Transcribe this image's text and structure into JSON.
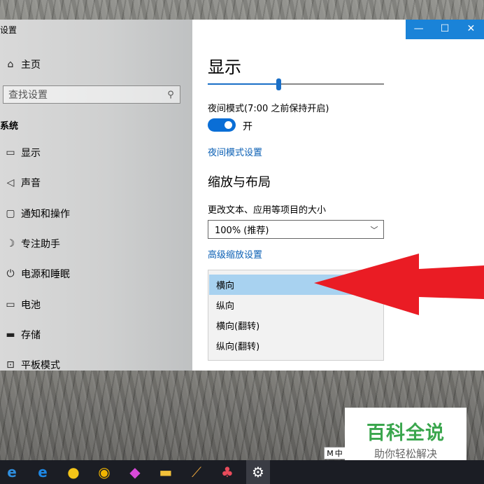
{
  "window": {
    "title": "设置",
    "controls": [
      "—",
      "☐",
      "✕"
    ]
  },
  "sidebar": {
    "home": "主页",
    "search_placeholder": "查找设置",
    "section": "系统",
    "items": [
      {
        "label": "显示",
        "icon": "monitor-icon"
      },
      {
        "label": "声音",
        "icon": "speaker-icon"
      },
      {
        "label": "通知和操作",
        "icon": "notification-icon"
      },
      {
        "label": "专注助手",
        "icon": "moon-icon"
      },
      {
        "label": "电源和睡眠",
        "icon": "power-icon"
      },
      {
        "label": "电池",
        "icon": "battery-icon"
      },
      {
        "label": "存储",
        "icon": "storage-icon"
      },
      {
        "label": "平板模式",
        "icon": "tablet-mode-icon"
      }
    ]
  },
  "main": {
    "title": "显示",
    "brightness_percent": 40,
    "night_light_label": "夜间模式(7:00 之前保持开启)",
    "night_light_state": "开",
    "night_light_on": true,
    "night_light_settings_link": "夜间模式设置",
    "scale_layout_heading": "缩放与布局",
    "scale_label": "更改文本、应用等项目的大小",
    "scale_value": "100% (推荐)",
    "advanced_scaling_link": "高级缩放设置",
    "orientation_options": [
      "横向",
      "纵向",
      "横向(翻转)",
      "纵向(翻转)"
    ],
    "orientation_selected": 0
  },
  "watermark": {
    "title": "百科全说",
    "subtitle": "助你轻松解决"
  },
  "ime": {
    "m": "M",
    "lang": "中"
  },
  "taskbar": {
    "icons": [
      "edge-legacy-icon",
      "ie-icon",
      "qq-icon",
      "browser-icon",
      "paint-icon",
      "file-explorer-icon",
      "broom-icon",
      "game-icon",
      "settings-gear-icon"
    ]
  },
  "colors": {
    "accent": "#1a6fc7",
    "titlebar_blue": "#1a83d8",
    "arrow_red": "#ea1c24",
    "watermark_green": "#3aa64d"
  }
}
